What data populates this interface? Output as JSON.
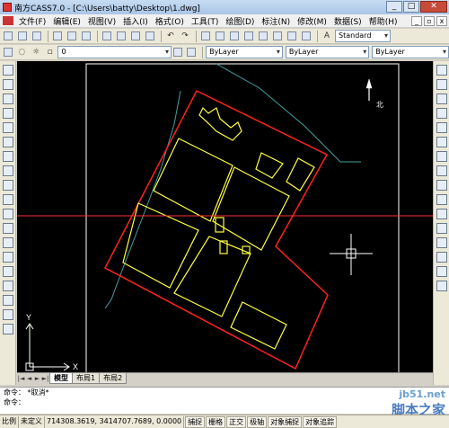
{
  "window": {
    "title": "南方CASS7.0 - [C:\\Users\\batty\\Desktop\\1.dwg]",
    "min": "_",
    "max": "□",
    "close": "✕"
  },
  "menu": [
    "文件(F)",
    "编辑(E)",
    "视图(V)",
    "插入(I)",
    "格式(O)",
    "工具(T)",
    "绘图(D)",
    "标注(N)",
    "修改(M)",
    "数据(S)",
    "帮助(H)"
  ],
  "toolbar": {
    "text_style": "Standard",
    "layer": "0",
    "color": "ByLayer",
    "linetype": "ByLayer",
    "lineweight": "ByLayer"
  },
  "canvas": {
    "north_label": "北"
  },
  "tabs": {
    "nav": [
      "|◄",
      "◄",
      "►",
      "►|"
    ],
    "items": [
      "模型",
      "布局1",
      "布局2"
    ]
  },
  "command": {
    "line1": "命令： *取消*",
    "line2": "命令："
  },
  "status": {
    "scale": "比例",
    "units": "未定义",
    "coords": "714308.3619, 3414707.7689, 0.0000",
    "buttons": [
      "捕捉",
      "栅格",
      "正交",
      "极轴",
      "对象捕捉",
      "对象追踪"
    ]
  },
  "watermark": {
    "site": "jb51.net",
    "name": "脚本之家"
  },
  "colors": {
    "boundary": "#ff2020",
    "buildings": "#ffff40",
    "road": "#40a0a0",
    "frame": "#ffffff",
    "crosshair": "#ff3030"
  }
}
